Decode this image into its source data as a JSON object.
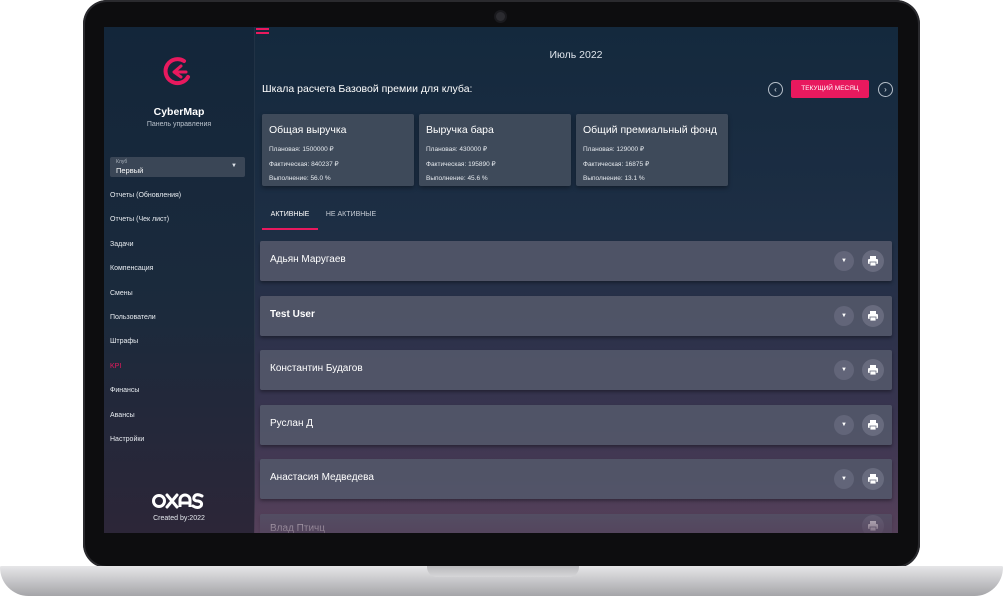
{
  "sidebar": {
    "brand": "CyberMap",
    "subtitle": "Панель управления",
    "club_label": "Клуб",
    "club_value": "Первый",
    "items": [
      {
        "label": "Отчеты (Обновления)"
      },
      {
        "label": "Отчеты (Чек лист)"
      },
      {
        "label": "Задачи"
      },
      {
        "label": "Компенсация"
      },
      {
        "label": "Смены"
      },
      {
        "label": "Пользователи"
      },
      {
        "label": "Штрафы"
      },
      {
        "label": "KPI"
      },
      {
        "label": "Финансы"
      },
      {
        "label": "Авансы"
      },
      {
        "label": "Настройки"
      }
    ],
    "footer_logo": "OXAS",
    "footer_text": "Created by:2022",
    "accent": "#e8195e"
  },
  "header": {
    "month": "Июль 2022",
    "scale_title": "Шкала расчета Базовой премии для клуба:",
    "current_month_button": "ТЕКУЩИЙ МЕСЯЦ",
    "prev_icon": "chevron-left-icon",
    "next_icon": "chevron-right-icon"
  },
  "cards": [
    {
      "title": "Общая выручка",
      "planned": "Плановая: 1500000 ₽",
      "actual": "Фактическая: 840237 ₽",
      "completion": "Выполнение: 56.0 %"
    },
    {
      "title": "Выручка бара",
      "planned": "Плановая: 430000 ₽",
      "actual": "Фактическая: 195890 ₽",
      "completion": "Выполнение: 45.6 %"
    },
    {
      "title": "Общий премиальный фонд",
      "planned": "Плановая: 129000 ₽",
      "actual": "Фактическая: 16875 ₽",
      "completion": "Выполнение: 13.1 %"
    }
  ],
  "tabs": [
    {
      "label": "АКТИВНЫЕ"
    },
    {
      "label": "НЕ АКТИВНЫЕ"
    }
  ],
  "employees": [
    {
      "name": "Адьян Маругаев"
    },
    {
      "name": "Test User"
    },
    {
      "name": "Константин Будагов"
    },
    {
      "name": "Руслан Д"
    },
    {
      "name": "Анастасия Медведева"
    },
    {
      "name": "Влад Птичц"
    }
  ]
}
